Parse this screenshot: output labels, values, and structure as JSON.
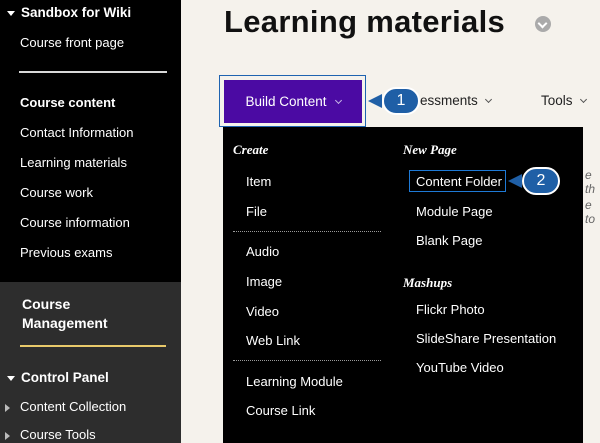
{
  "sidebar": {
    "course_title": "Sandbox for Wiki",
    "front_page": "Course front page",
    "section_title": "Course content",
    "items": [
      "Contact Information",
      "Learning materials",
      "Course work",
      "Course information",
      "Previous exams"
    ]
  },
  "management": {
    "title": "Course Management",
    "control_panel": "Control Panel",
    "items": [
      "Content Collection",
      "Course Tools"
    ]
  },
  "main": {
    "title": "Learning materials",
    "toolbar": {
      "build_content": "Build Content",
      "assessments": "essments",
      "tools": "Tools"
    },
    "background_text": [
      "e th",
      "e to"
    ]
  },
  "dropdown": {
    "create_heading": "Create",
    "create_items": [
      "Item",
      "File"
    ],
    "media_items": [
      "Audio",
      "Image",
      "Video",
      "Web Link"
    ],
    "module_items": [
      "Learning Module",
      "Course Link"
    ],
    "new_page_heading": "New Page",
    "new_page_items": [
      "Content Folder",
      "Module Page",
      "Blank Page"
    ],
    "mashups_heading": "Mashups",
    "mashups_items": [
      "Flickr Photo",
      "SlideShare Presentation",
      "YouTube Video"
    ]
  },
  "callouts": [
    "1",
    "2"
  ],
  "colors": {
    "build_button": "#4b0aa3",
    "callout": "#1f5fa6",
    "highlight_border": "#1e7ad6"
  }
}
